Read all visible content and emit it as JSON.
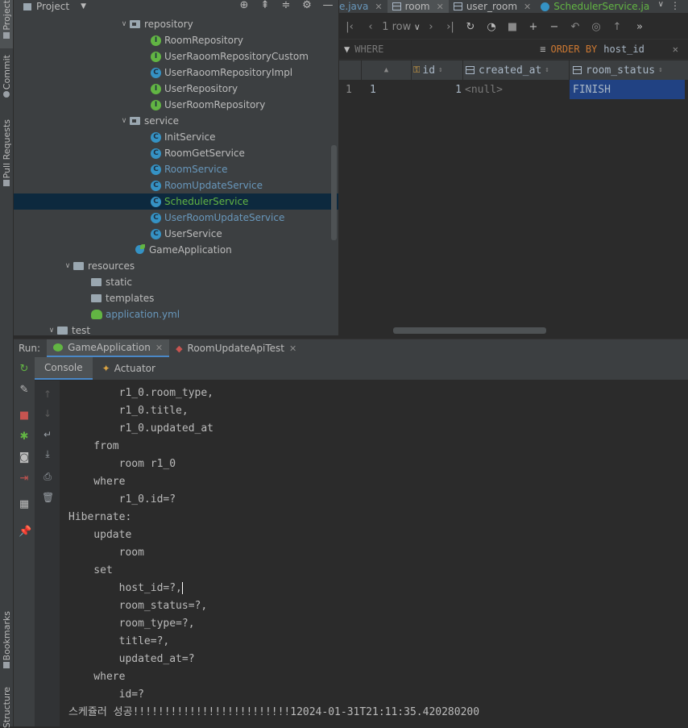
{
  "left_tool_strip": {
    "tabs": [
      {
        "label": "Project",
        "icon": "folder-icon"
      },
      {
        "label": "Commit",
        "icon": "commit-icon"
      },
      {
        "label": "Pull Requests",
        "icon": "pull-request-icon"
      },
      {
        "label": "Bookmarks",
        "icon": "bookmark-icon"
      },
      {
        "label": "Structure",
        "icon": "structure-icon"
      }
    ]
  },
  "project_panel": {
    "title": "Project",
    "header_icons": [
      "locate-icon",
      "collapse-all-icon",
      "expand-all-icon",
      "gear-icon",
      "minimize-icon"
    ],
    "tree": [
      {
        "label": "repository",
        "type": "package",
        "expanded": true,
        "color": "#bbbbbb"
      },
      {
        "label": "RoomRepository",
        "type": "interface",
        "color": "#bbbbbb"
      },
      {
        "label": "UserRaoomRepositoryCustom",
        "type": "interface",
        "color": "#bbbbbb"
      },
      {
        "label": "UserRaoomRepositoryImpl",
        "type": "class",
        "color": "#bbbbbb"
      },
      {
        "label": "UserRepository",
        "type": "interface",
        "color": "#bbbbbb"
      },
      {
        "label": "UserRoomRepository",
        "type": "interface",
        "color": "#bbbbbb"
      },
      {
        "label": "service",
        "type": "package",
        "expanded": true,
        "color": "#bbbbbb"
      },
      {
        "label": "InitService",
        "type": "class",
        "color": "#bbbbbb"
      },
      {
        "label": "RoomGetService",
        "type": "class",
        "color": "#bbbbbb"
      },
      {
        "label": "RoomService",
        "type": "class",
        "color": "#6897bb"
      },
      {
        "label": "RoomUpdateService",
        "type": "class",
        "color": "#6897bb"
      },
      {
        "label": "SchedulerService",
        "type": "class",
        "color": "#62b543",
        "selected": true
      },
      {
        "label": "UserRoomUpdateService",
        "type": "class",
        "color": "#6897bb"
      },
      {
        "label": "UserService",
        "type": "class",
        "color": "#bbbbbb"
      },
      {
        "label": "GameApplication",
        "type": "application",
        "color": "#bbbbbb"
      },
      {
        "label": "resources",
        "type": "resources-folder",
        "expanded": true,
        "color": "#bbbbbb"
      },
      {
        "label": "static",
        "type": "folder",
        "color": "#bbbbbb"
      },
      {
        "label": "templates",
        "type": "folder",
        "color": "#bbbbbb"
      },
      {
        "label": "application.yml",
        "type": "yml",
        "color": "#6897bb"
      },
      {
        "label": "test",
        "type": "folder",
        "expanded": true,
        "color": "#bbbbbb"
      }
    ]
  },
  "editor_tabs": [
    {
      "label": "e.java",
      "icon": "none",
      "active": false,
      "color": "#6897bb"
    },
    {
      "label": "room",
      "icon": "table-icon",
      "active": true,
      "color": "#bbbbbb"
    },
    {
      "label": "user_room",
      "icon": "table-icon",
      "active": false,
      "color": "#bbbbbb"
    },
    {
      "label": "SchedulerService.ja",
      "icon": "class-icon",
      "active": false,
      "color": "#62b543"
    }
  ],
  "db_toolbar": {
    "row_count": "1 row",
    "icons": [
      "first-page-icon",
      "prev-page-icon",
      "next-page-icon",
      "last-page-icon",
      "refresh-icon",
      "history-icon",
      "stop-icon",
      "add-row-icon",
      "delete-row-icon",
      "revert-icon",
      "preview-icon",
      "submit-icon",
      "more-icon"
    ]
  },
  "filter_bar": {
    "where_label": "WHERE",
    "order_keyword": "ORDER BY",
    "order_value": "host_id"
  },
  "grid": {
    "columns": [
      "id",
      "created_at",
      "room_status"
    ],
    "rows": [
      {
        "row_num": "1",
        "mark": "1",
        "id": "1",
        "created_at": "<null>",
        "room_status": "FINISH"
      }
    ]
  },
  "run_panel": {
    "label": "Run:",
    "tabs": [
      {
        "label": "GameApplication",
        "active": true
      },
      {
        "label": "RoomUpdateApiTest",
        "active": false
      }
    ],
    "console_tabs": [
      {
        "label": "Console",
        "active": true
      },
      {
        "label": "Actuator",
        "active": false
      }
    ],
    "log_lines": [
      "        r1_0.room_type,",
      "        r1_0.title,",
      "        r1_0.updated_at",
      "    from",
      "        room r1_0",
      "    where",
      "        r1_0.id=?",
      "Hibernate: ",
      "    update",
      "        room ",
      "    set",
      "        host_id=?,",
      "        room_status=?,",
      "        room_type=?,",
      "        title=?,",
      "        updated_at=? ",
      "    where",
      "        id=?",
      "스케쥴러 성공!!!!!!!!!!!!!!!!!!!!!!!!!12024-01-31T21:11:35.420280200"
    ]
  }
}
